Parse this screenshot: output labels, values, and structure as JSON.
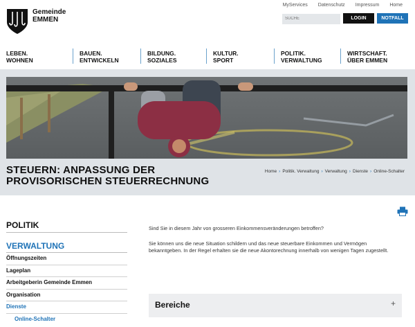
{
  "header": {
    "logo": {
      "line1": "Gemeinde",
      "line2": "EMMEN"
    },
    "top_links": [
      "MyServices",
      "Datenschutz",
      "Impressum",
      "Home"
    ],
    "search_placeholder": "SUCHE",
    "login_label": "LOGIN",
    "notfall_label": "NOTFALL",
    "notfall_color": "#1f73b7"
  },
  "nav": [
    {
      "line1": "LEBEN.",
      "line2": "WOHNEN"
    },
    {
      "line1": "BAUEN.",
      "line2": "ENTWICKELN"
    },
    {
      "line1": "BILDUNG.",
      "line2": "SOZIALES"
    },
    {
      "line1": "KULTUR.",
      "line2": "SPORT"
    },
    {
      "line1": "POLITIK.",
      "line2": "VERWALTUNG"
    },
    {
      "line1": "WIRTSCHAFT.",
      "line2": "ÜBER EMMEN"
    }
  ],
  "page": {
    "title_line1": "STEUERN: ANPASSUNG DER",
    "title_line2": "PROVISORISCHEN STEUERRECHNUNG",
    "breadcrumb": [
      "Home",
      "Politik. Verwaltung",
      "Verwaltung",
      "Dienste",
      "Online-Schalter"
    ]
  },
  "sidebar": {
    "heading": "POLITIK",
    "subheading": "VERWALTUNG",
    "items": [
      "Öffnungszeiten",
      "Lageplan",
      "Arbeitgeberin Gemeinde Emmen",
      "Organisation",
      "Dienste"
    ],
    "sub_item": "Online-Schalter"
  },
  "content": {
    "p1": "Sind Sie in diesem Jahr von grosseren Einkommensveränderungen betroffen?",
    "p2": "Sie können uns die neue Situation schildern und das neue steuerbare Einkommen und Vermögen bekanntgeben. In der Regel erhalten sie die neue Akontorechnung innerhalb von wenigen Tagen zugestellt.",
    "accordion_title": "Bereiche",
    "accordion_toggle": "+"
  },
  "icons": {
    "print": "printer-icon",
    "logo": "hooks-shield-icon"
  },
  "colors": {
    "accent": "#1f73b7",
    "band": "#dfe3e7"
  }
}
